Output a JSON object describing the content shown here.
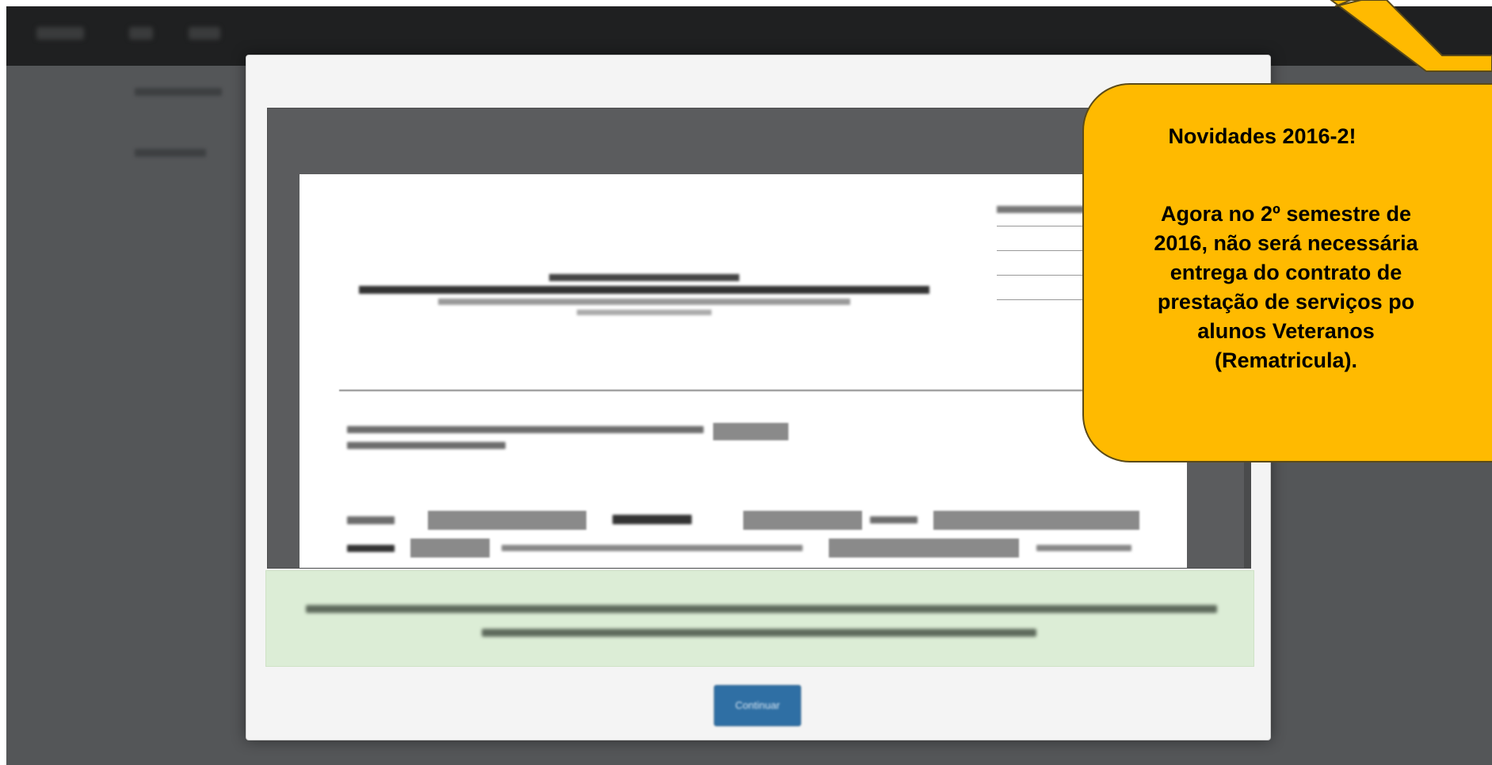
{
  "modal": {
    "ok_button_label": "Continuar"
  },
  "callout": {
    "heading": "Novidades 2016-2!",
    "body": "Agora no 2º semestre de\n2016, não será necessária\nentrega do contrato de\nprestação de serviços po\nalunos Veteranos\n(Rematricula).",
    "color": "#ffba00"
  }
}
